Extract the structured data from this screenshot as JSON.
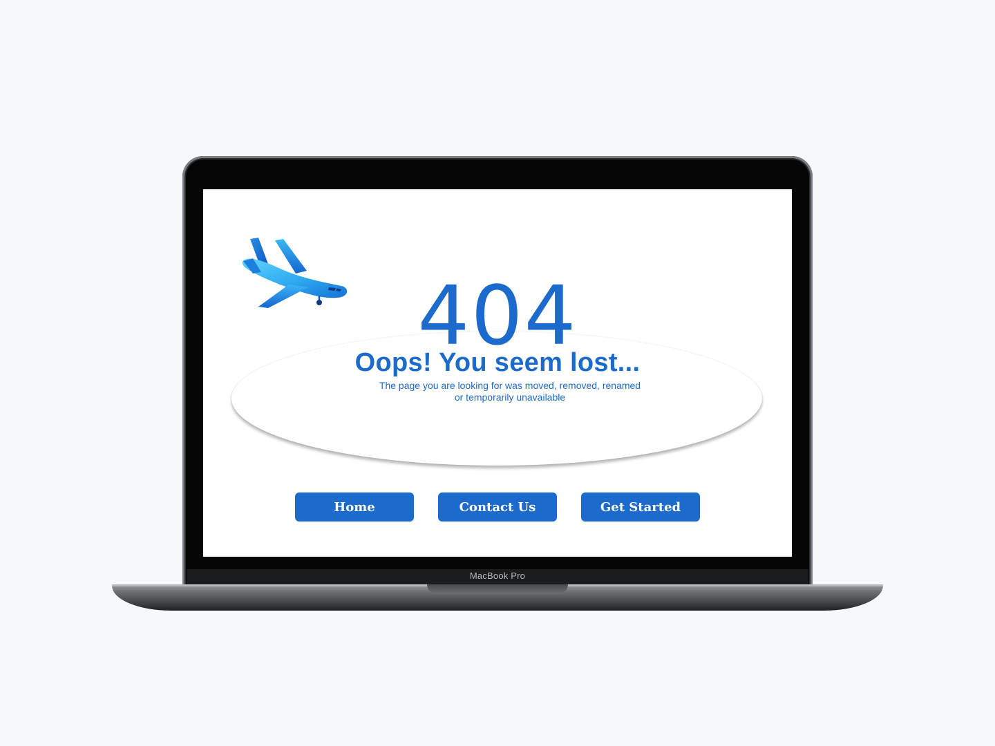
{
  "device": {
    "model_label": "MacBook Pro"
  },
  "error_page": {
    "code": "404",
    "headline": "Oops! You seem lost...",
    "subtext_line1": "The page you are looking for was moved, removed, renamed",
    "subtext_line2": "or temporarily unavailable",
    "illustration": "airplane-icon"
  },
  "buttons": {
    "home": "Home",
    "contact": "Contact Us",
    "get_started": "Get Started"
  },
  "colors": {
    "accent": "#1c6bcc",
    "page_background": "#f7f8fa",
    "screen_background": "#ffffff",
    "button_text": "#ffffff"
  }
}
